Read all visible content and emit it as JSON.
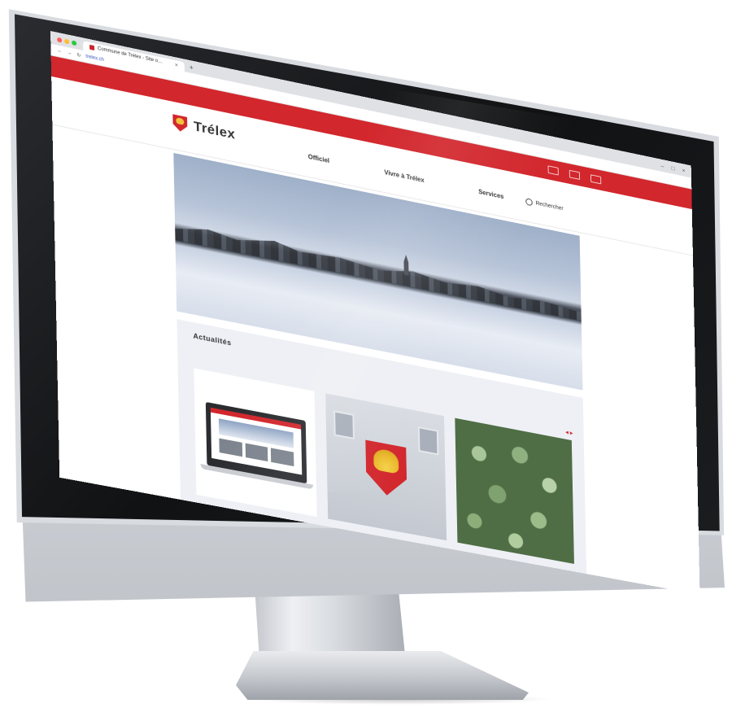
{
  "browser": {
    "tab_title": "Commune de Trélex - Site o…",
    "url": "trelex.ch",
    "traffic_colors": [
      "#ff5f57",
      "#febc2e",
      "#28c840"
    ]
  },
  "site": {
    "name": "Trélex",
    "brand_color": "#d2272d",
    "nav": [
      "Officiel",
      "Vivre à Trélex",
      "Services"
    ],
    "search_placeholder": "Rechercher"
  },
  "news": {
    "title": "Actualités",
    "prev_arrow": "◂",
    "next_arrow": "▸"
  }
}
